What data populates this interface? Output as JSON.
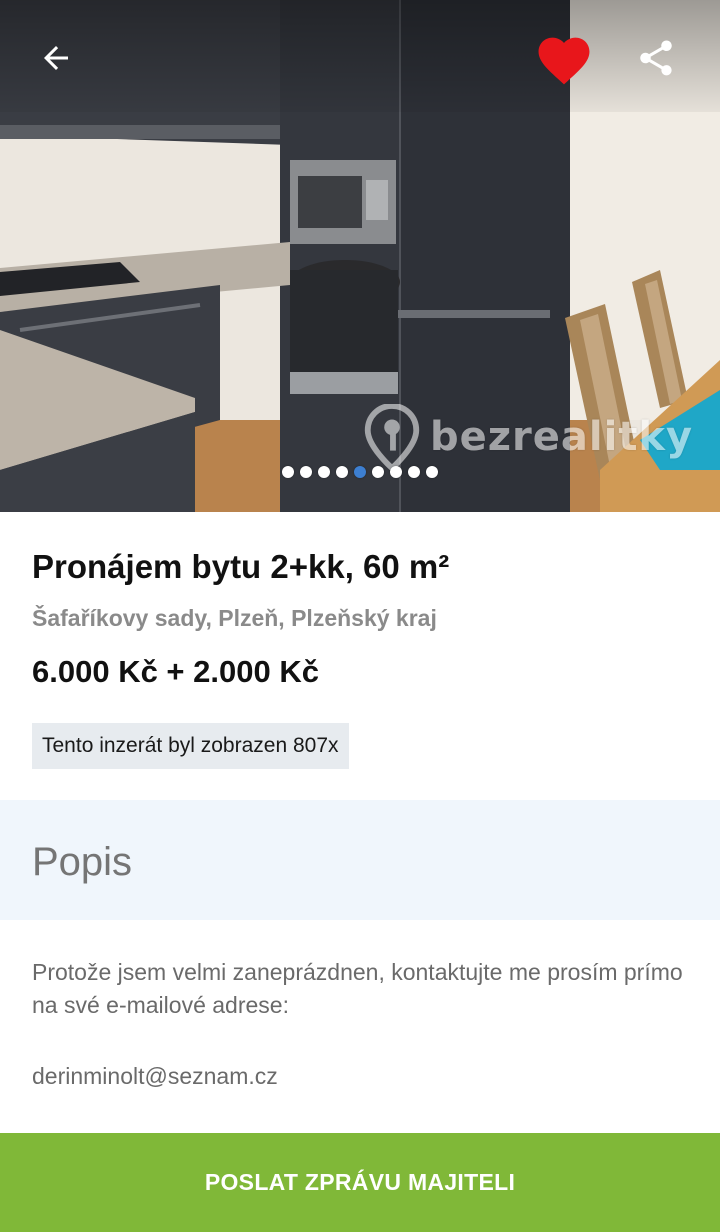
{
  "listing": {
    "title": "Pronájem bytu 2+kk, 60 m²",
    "address": "Šafaříkovy sady, Plzeň, Plzeňský kraj",
    "price": "6.000 Kč + 2.000 Kč",
    "views_badge": "Tento inzerát byl zobrazen 807x"
  },
  "gallery": {
    "image_count": 9,
    "active_index": 4,
    "watermark": "bezrealitky",
    "is_favorite": true,
    "colors": {
      "favorite": "#e8161b",
      "active_dot": "#3d7fd1"
    }
  },
  "icons": {
    "back": "arrow-left-icon",
    "favorite": "heart-icon",
    "share": "share-icon"
  },
  "description": {
    "heading": "Popis",
    "text": "Protože jsem velmi zaneprázdnen, kontaktujte me prosím prímo na své e-mailové adrese:",
    "email": "derinminolt@seznam.cz"
  },
  "cta": {
    "label": "POSLAT ZPRÁVU MAJITELI",
    "color": "#80b838"
  }
}
